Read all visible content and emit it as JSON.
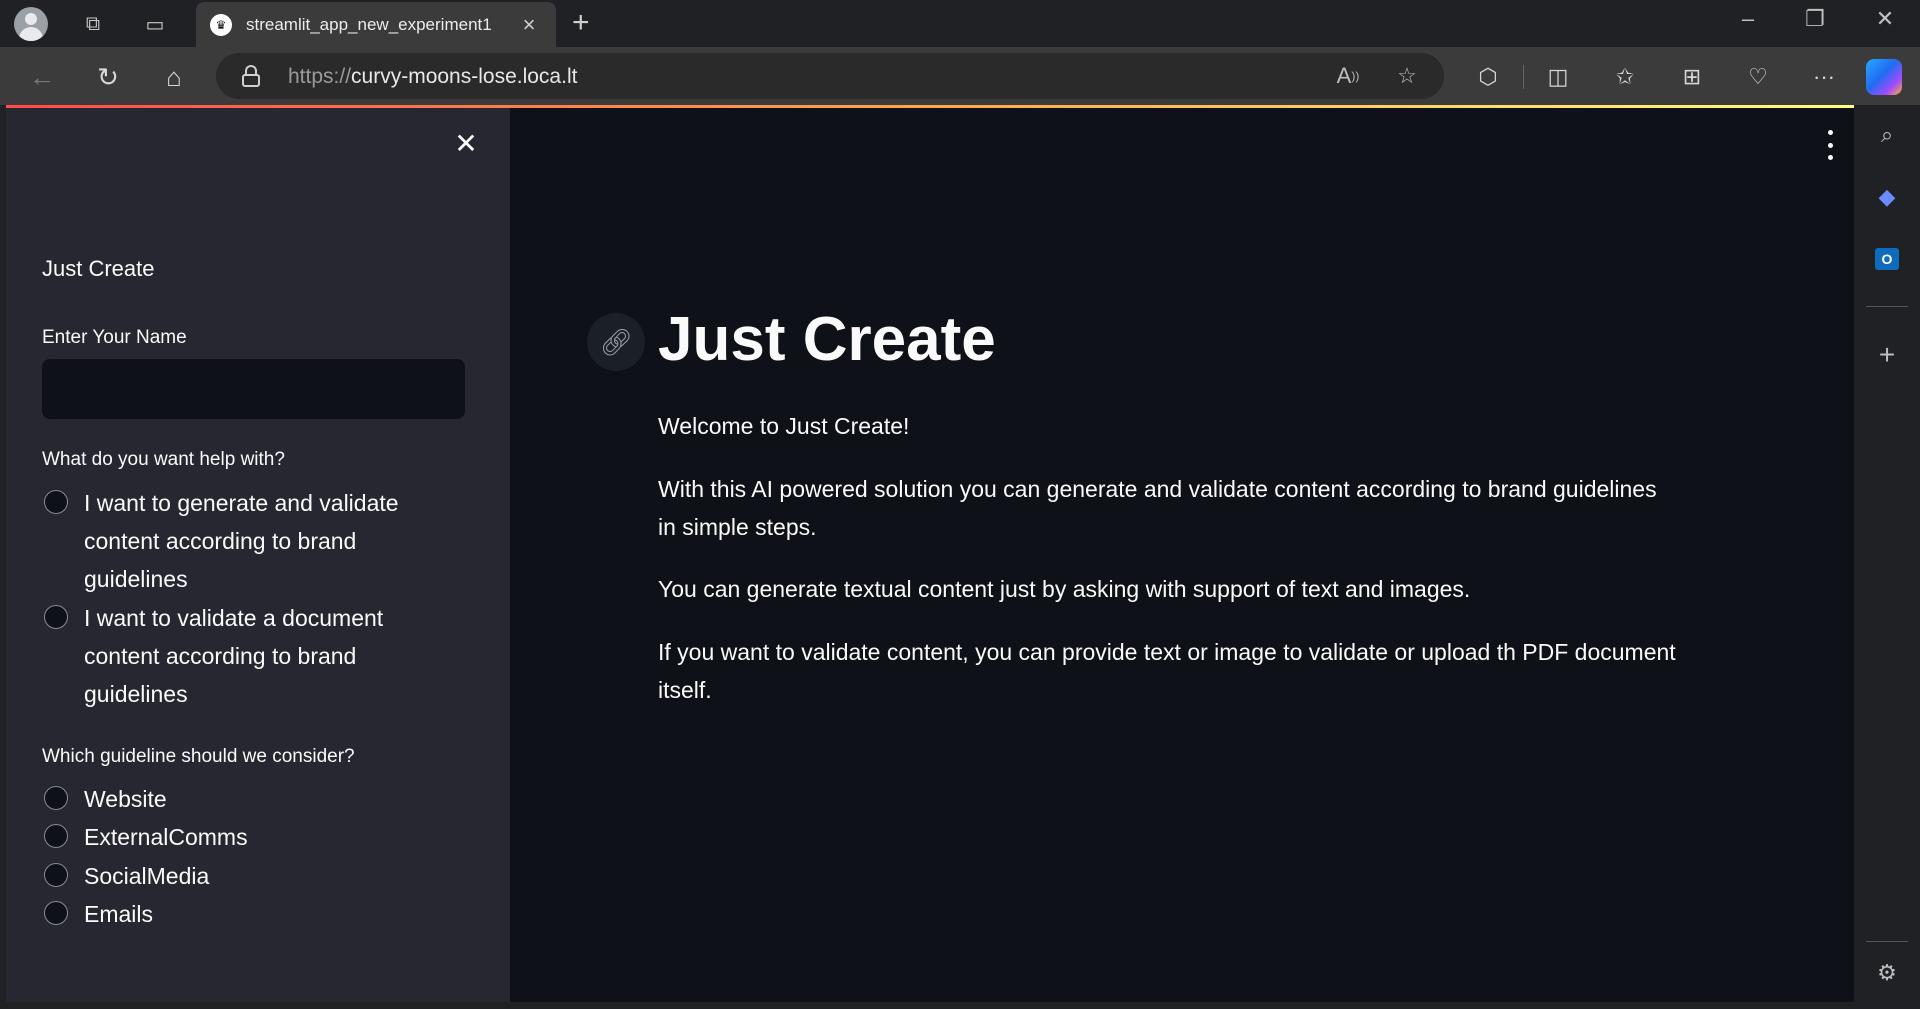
{
  "browser": {
    "tab_title": "streamlit_app_new_experiment1",
    "url_scheme": "https://",
    "url_host": "curvy-moons-lose.loca.lt"
  },
  "sidebar": {
    "title": "Just Create",
    "name_label": "Enter Your Name",
    "name_value": "",
    "help_label": "What do you want help with?",
    "help_options": [
      "I want to generate and validate content according to brand guidelines",
      "I want to validate a document content according to brand guidelines"
    ],
    "guideline_label": "Which guideline should we consider?",
    "guideline_options": [
      "Website",
      "ExternalComms",
      "SocialMedia",
      "Emails"
    ]
  },
  "main": {
    "title": "Just Create",
    "paragraphs": [
      "Welcome to Just Create!",
      "With this AI powered solution you can generate and validate content according to brand guidelines in simple steps.",
      "You can generate textual content just by asking with support of text and images.",
      "If you want to validate content, you can provide text or image to validate or upload th PDF document itself."
    ]
  },
  "colors": {
    "app_background": "#0e1117",
    "sidebar_background": "#262730",
    "text": "#fafafa",
    "accent_gradient_start": "#ff4b4b",
    "accent_gradient_end": "#fffd80"
  }
}
